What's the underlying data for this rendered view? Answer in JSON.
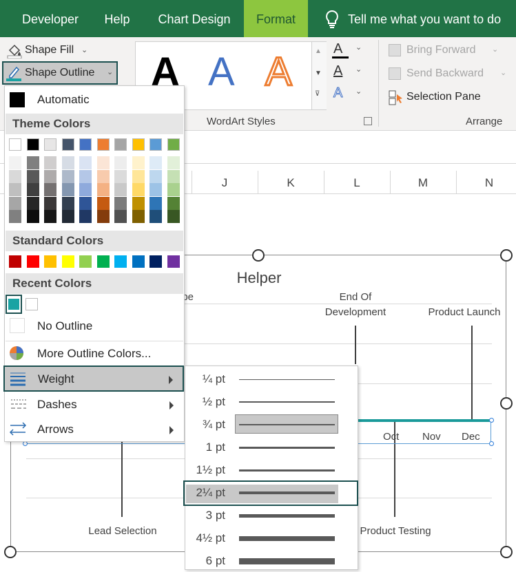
{
  "tabs": [
    {
      "label": "Developer",
      "active": false
    },
    {
      "label": "Help",
      "active": false
    },
    {
      "label": "Chart Design",
      "active": false
    },
    {
      "label": "Format",
      "active": true
    }
  ],
  "tell_me": "Tell me what you want to do",
  "ribbon": {
    "shape_fill": "Shape Fill",
    "shape_outline": "Shape Outline",
    "wordart_letter": "A",
    "wordart_group": "WordArt Styles",
    "text_fill_letter": "A",
    "text_outline_letter": "A",
    "text_effects_letter": "A",
    "bring_forward": "Bring Forward",
    "send_backward": "Send Backward",
    "selection_pane": "Selection Pane",
    "arrange_group": "Arrange"
  },
  "columns": [
    "J",
    "K",
    "L",
    "M",
    "N"
  ],
  "chart": {
    "title": "Helper",
    "labels": {
      "end_of_development_1": "End Of",
      "end_of_development_2": "Development",
      "product_launch": "Product Launch",
      "lead_selection": "Lead Selection",
      "product_testing": "Product Testing",
      "partial_scope": "ope"
    },
    "months": [
      "p",
      "Oct",
      "Nov",
      "Dec"
    ]
  },
  "menu": {
    "automatic": "Automatic",
    "theme_colors": "Theme Colors",
    "standard_colors": "Standard Colors",
    "recent_colors": "Recent Colors",
    "no_outline": "No Outline",
    "more_colors": "More Outline Colors...",
    "weight": "Weight",
    "dashes": "Dashes",
    "arrows": "Arrows",
    "theme_top": [
      "#ffffff",
      "#000000",
      "#e7e6e6",
      "#44546a",
      "#4472c4",
      "#ed7d31",
      "#a5a5a5",
      "#ffc000",
      "#5b9bd5",
      "#70ad47"
    ],
    "theme_shades": [
      [
        "#f2f2f2",
        "#808080",
        "#d0cece",
        "#d6dce5",
        "#dae3f3",
        "#fbe5d6",
        "#ededed",
        "#fff2cc",
        "#deebf7",
        "#e2f0d9"
      ],
      [
        "#d9d9d9",
        "#595959",
        "#aeabab",
        "#adb9ca",
        "#b4c7e7",
        "#f8cbad",
        "#dbdbdb",
        "#ffe699",
        "#bdd7ee",
        "#c5e0b4"
      ],
      [
        "#bfbfbf",
        "#404040",
        "#757171",
        "#8497b0",
        "#8faadc",
        "#f4b183",
        "#c9c9c9",
        "#ffd966",
        "#9dc3e6",
        "#a9d18e"
      ],
      [
        "#a6a6a6",
        "#262626",
        "#3b3838",
        "#333f50",
        "#2f5597",
        "#c55a11",
        "#7b7b7b",
        "#bf9000",
        "#2e75b6",
        "#548235"
      ],
      [
        "#808080",
        "#0d0d0d",
        "#171717",
        "#222a35",
        "#203864",
        "#843c0c",
        "#525252",
        "#7f6000",
        "#1f4e79",
        "#385723"
      ]
    ],
    "standard": [
      "#c00000",
      "#ff0000",
      "#ffc000",
      "#ffff00",
      "#92d050",
      "#00b050",
      "#00b0f0",
      "#0070c0",
      "#002060",
      "#7030a0"
    ],
    "recent": [
      "#1aa3a3",
      "#ffffff"
    ]
  },
  "weights": [
    {
      "label": "¼ pt",
      "thickness": 1
    },
    {
      "label": "½ pt",
      "thickness": 2
    },
    {
      "label": "¾ pt",
      "thickness": 2
    },
    {
      "label": "1 pt",
      "thickness": 3
    },
    {
      "label": "1½ pt",
      "thickness": 3
    },
    {
      "label": "2¼ pt",
      "thickness": 4
    },
    {
      "label": "3 pt",
      "thickness": 5
    },
    {
      "label": "4½ pt",
      "thickness": 7
    },
    {
      "label": "6 pt",
      "thickness": 9
    }
  ]
}
